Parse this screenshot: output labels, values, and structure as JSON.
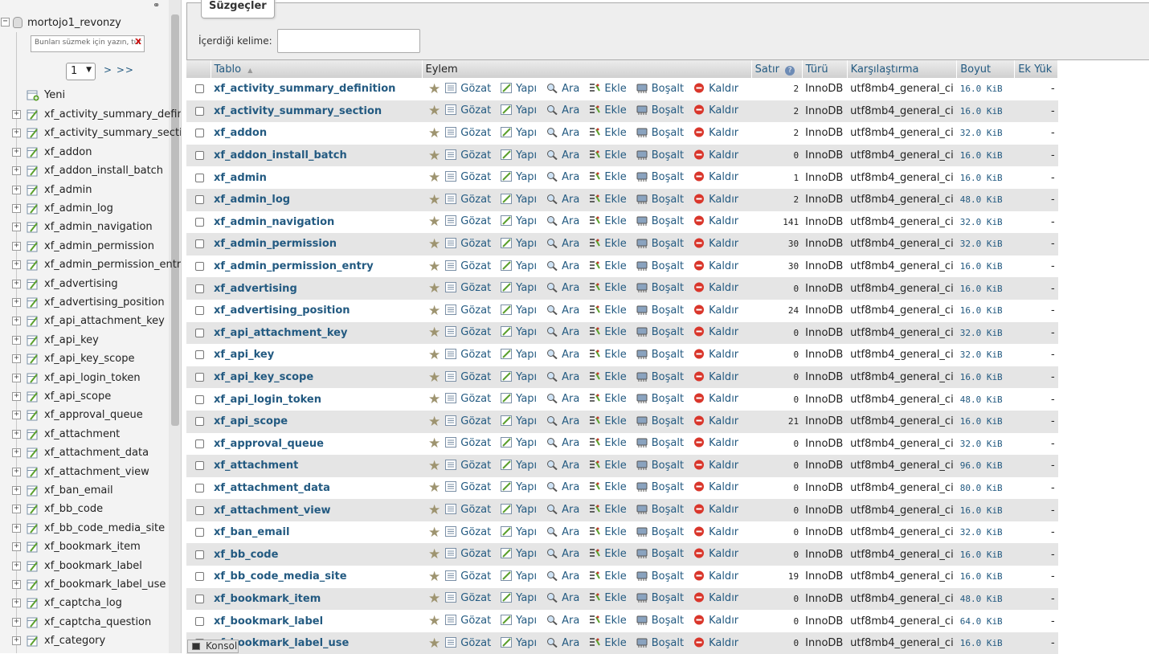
{
  "nav": {
    "db_name": "mortojo1_revonzy",
    "filter_placeholder": "Bunları süzmek için yazın, tür",
    "filter_clear": "X",
    "page_select": "1",
    "page_next": "> >>",
    "new_label": "Yeni",
    "tables": [
      "xf_activity_summary_defin",
      "xf_activity_summary_secti",
      "xf_addon",
      "xf_addon_install_batch",
      "xf_admin",
      "xf_admin_log",
      "xf_admin_navigation",
      "xf_admin_permission",
      "xf_admin_permission_entr",
      "xf_advertising",
      "xf_advertising_position",
      "xf_api_attachment_key",
      "xf_api_key",
      "xf_api_key_scope",
      "xf_api_login_token",
      "xf_api_scope",
      "xf_approval_queue",
      "xf_attachment",
      "xf_attachment_data",
      "xf_attachment_view",
      "xf_ban_email",
      "xf_bb_code",
      "xf_bb_code_media_site",
      "xf_bookmark_item",
      "xf_bookmark_label",
      "xf_bookmark_label_use",
      "xf_captcha_log",
      "xf_captcha_question",
      "xf_category"
    ]
  },
  "filters": {
    "legend": "Süzgeçler",
    "keyword_label": "İçerdiği kelime:",
    "keyword_value": ""
  },
  "table": {
    "headers": {
      "table": "Tablo",
      "sort_indicator": "▲",
      "action": "Eylem",
      "rows": "Satır",
      "help": "?",
      "type": "Türü",
      "collation": "Karşılaştırma",
      "size": "Boyut",
      "overhead": "Ek Yük"
    },
    "actions": {
      "browse": "Gözat",
      "structure": "Yapı",
      "search": "Ara",
      "insert": "Ekle",
      "empty": "Boşalt",
      "drop": "Kaldır"
    },
    "rows": [
      {
        "name": "xf_activity_summary_definition",
        "rows": "2",
        "engine": "InnoDB",
        "collation": "utf8mb4_general_ci",
        "size": "16.0 KiB",
        "overhead": "-"
      },
      {
        "name": "xf_activity_summary_section",
        "rows": "2",
        "engine": "InnoDB",
        "collation": "utf8mb4_general_ci",
        "size": "16.0 KiB",
        "overhead": "-"
      },
      {
        "name": "xf_addon",
        "rows": "2",
        "engine": "InnoDB",
        "collation": "utf8mb4_general_ci",
        "size": "32.0 KiB",
        "overhead": "-"
      },
      {
        "name": "xf_addon_install_batch",
        "rows": "0",
        "engine": "InnoDB",
        "collation": "utf8mb4_general_ci",
        "size": "16.0 KiB",
        "overhead": "-"
      },
      {
        "name": "xf_admin",
        "rows": "1",
        "engine": "InnoDB",
        "collation": "utf8mb4_general_ci",
        "size": "16.0 KiB",
        "overhead": "-"
      },
      {
        "name": "xf_admin_log",
        "rows": "2",
        "engine": "InnoDB",
        "collation": "utf8mb4_general_ci",
        "size": "48.0 KiB",
        "overhead": "-"
      },
      {
        "name": "xf_admin_navigation",
        "rows": "141",
        "engine": "InnoDB",
        "collation": "utf8mb4_general_ci",
        "size": "32.0 KiB",
        "overhead": "-"
      },
      {
        "name": "xf_admin_permission",
        "rows": "30",
        "engine": "InnoDB",
        "collation": "utf8mb4_general_ci",
        "size": "32.0 KiB",
        "overhead": "-"
      },
      {
        "name": "xf_admin_permission_entry",
        "rows": "30",
        "engine": "InnoDB",
        "collation": "utf8mb4_general_ci",
        "size": "16.0 KiB",
        "overhead": "-"
      },
      {
        "name": "xf_advertising",
        "rows": "0",
        "engine": "InnoDB",
        "collation": "utf8mb4_general_ci",
        "size": "16.0 KiB",
        "overhead": "-"
      },
      {
        "name": "xf_advertising_position",
        "rows": "24",
        "engine": "InnoDB",
        "collation": "utf8mb4_general_ci",
        "size": "16.0 KiB",
        "overhead": "-"
      },
      {
        "name": "xf_api_attachment_key",
        "rows": "0",
        "engine": "InnoDB",
        "collation": "utf8mb4_general_ci",
        "size": "32.0 KiB",
        "overhead": "-"
      },
      {
        "name": "xf_api_key",
        "rows": "0",
        "engine": "InnoDB",
        "collation": "utf8mb4_general_ci",
        "size": "32.0 KiB",
        "overhead": "-"
      },
      {
        "name": "xf_api_key_scope",
        "rows": "0",
        "engine": "InnoDB",
        "collation": "utf8mb4_general_ci",
        "size": "16.0 KiB",
        "overhead": "-"
      },
      {
        "name": "xf_api_login_token",
        "rows": "0",
        "engine": "InnoDB",
        "collation": "utf8mb4_general_ci",
        "size": "48.0 KiB",
        "overhead": "-"
      },
      {
        "name": "xf_api_scope",
        "rows": "21",
        "engine": "InnoDB",
        "collation": "utf8mb4_general_ci",
        "size": "16.0 KiB",
        "overhead": "-"
      },
      {
        "name": "xf_approval_queue",
        "rows": "0",
        "engine": "InnoDB",
        "collation": "utf8mb4_general_ci",
        "size": "32.0 KiB",
        "overhead": "-"
      },
      {
        "name": "xf_attachment",
        "rows": "0",
        "engine": "InnoDB",
        "collation": "utf8mb4_general_ci",
        "size": "96.0 KiB",
        "overhead": "-"
      },
      {
        "name": "xf_attachment_data",
        "rows": "0",
        "engine": "InnoDB",
        "collation": "utf8mb4_general_ci",
        "size": "80.0 KiB",
        "overhead": "-"
      },
      {
        "name": "xf_attachment_view",
        "rows": "0",
        "engine": "InnoDB",
        "collation": "utf8mb4_general_ci",
        "size": "16.0 KiB",
        "overhead": "-"
      },
      {
        "name": "xf_ban_email",
        "rows": "0",
        "engine": "InnoDB",
        "collation": "utf8mb4_general_ci",
        "size": "32.0 KiB",
        "overhead": "-"
      },
      {
        "name": "xf_bb_code",
        "rows": "0",
        "engine": "InnoDB",
        "collation": "utf8mb4_general_ci",
        "size": "16.0 KiB",
        "overhead": "-"
      },
      {
        "name": "xf_bb_code_media_site",
        "rows": "19",
        "engine": "InnoDB",
        "collation": "utf8mb4_general_ci",
        "size": "16.0 KiB",
        "overhead": "-"
      },
      {
        "name": "xf_bookmark_item",
        "rows": "0",
        "engine": "InnoDB",
        "collation": "utf8mb4_general_ci",
        "size": "48.0 KiB",
        "overhead": "-"
      },
      {
        "name": "xf_bookmark_label",
        "rows": "0",
        "engine": "InnoDB",
        "collation": "utf8mb4_general_ci",
        "size": "64.0 KiB",
        "overhead": "-"
      },
      {
        "name": "xf_bookmark_label_use",
        "rows": "0",
        "engine": "InnoDB",
        "collation": "utf8mb4_general_ci",
        "size": "16.0 KiB",
        "overhead": "-"
      }
    ]
  },
  "console": {
    "label": "Konsol"
  }
}
